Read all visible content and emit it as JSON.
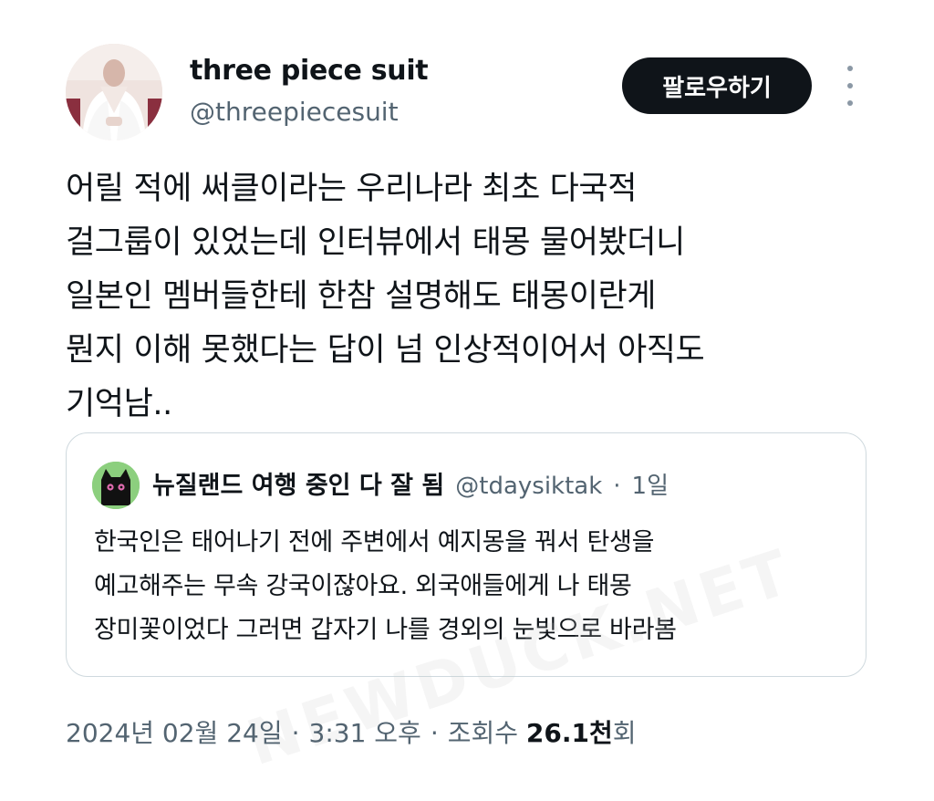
{
  "post": {
    "author": {
      "name": "three piece suit",
      "handle": "@threepiecesuit"
    },
    "follow_label": "팔로우하기",
    "more_icon": "more-vertical-icon",
    "text_lines": [
      "어릴 적에 써클이라는 우리나라 최초 다국적",
      "걸그룹이 있었는데 인터뷰에서 태몽 물어봤더니",
      "일본인 멤버들한테 한참 설명해도 태몽이란게",
      "뭔지 이해 못했다는 답이 넘 인상적이어서 아직도",
      "기억남.."
    ],
    "quote": {
      "author_name": "뉴질랜드 여행 중인 다 잘 됨",
      "handle": "@tdaysiktak",
      "separator": "·",
      "time": "1일",
      "text_lines": [
        "한국인은 태어나기 전에 주변에서 예지몽을 꿔서 탄생을",
        "예고해주는 무속 강국이잖아요. 외국애들에게 나 태몽",
        "장미꽃이었다 그러면 갑자기 나를 경외의 눈빛으로 바라봄"
      ]
    },
    "footer": {
      "date": "2024년 02월 24일",
      "sep1": "·",
      "time": "3:31 오후",
      "sep2": "·",
      "views_label": "조회수",
      "views_number": "26.1",
      "views_unit": "천",
      "views_suffix": "회"
    }
  },
  "watermark": "NEWDUCK.NET",
  "colors": {
    "text": "#0f1419",
    "secondary": "#536471",
    "follow_button_bg": "#0f1419",
    "follow_button_text": "#ffffff",
    "border": "#cfd9de",
    "quote_avatar_bg": "#8ccf7e"
  }
}
